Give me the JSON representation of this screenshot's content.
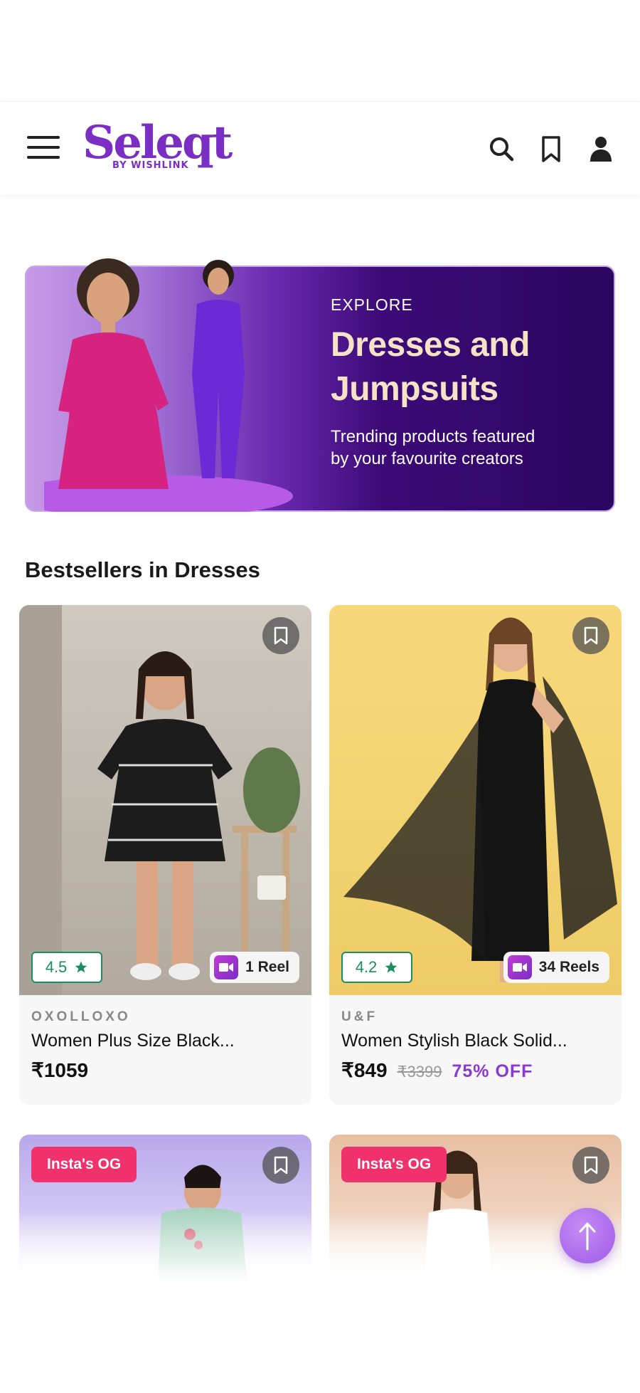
{
  "header": {
    "logo_text": "Seleqt",
    "logo_sub": "BY WISHLINK"
  },
  "banner": {
    "eyebrow": "EXPLORE",
    "title_line1": "Dresses and",
    "title_line2": "Jumpsuits",
    "subtitle_line1": "Trending products featured",
    "subtitle_line2": "by your favourite creators"
  },
  "section": {
    "title": "Bestsellers in Dresses"
  },
  "products": [
    {
      "rating": "4.5",
      "reels": "1 Reel",
      "brand": "OXOLLOXO",
      "name": "Women Plus Size Black...",
      "price": "₹1059",
      "mrp": "",
      "discount": ""
    },
    {
      "rating": "4.2",
      "reels": "34 Reels",
      "brand": "U&F",
      "name": "Women Stylish Black Solid...",
      "price": "₹849",
      "mrp": "₹3399",
      "discount": "75% OFF"
    }
  ],
  "promo_cards": [
    {
      "badge": "Insta's OG"
    },
    {
      "badge": "Insta's OG"
    }
  ],
  "colors": {
    "brand": "#7a2ec4",
    "rating_green": "#1b8e5e",
    "discount_purple": "#8a3ad0",
    "insta_badge": "#f0316b"
  }
}
